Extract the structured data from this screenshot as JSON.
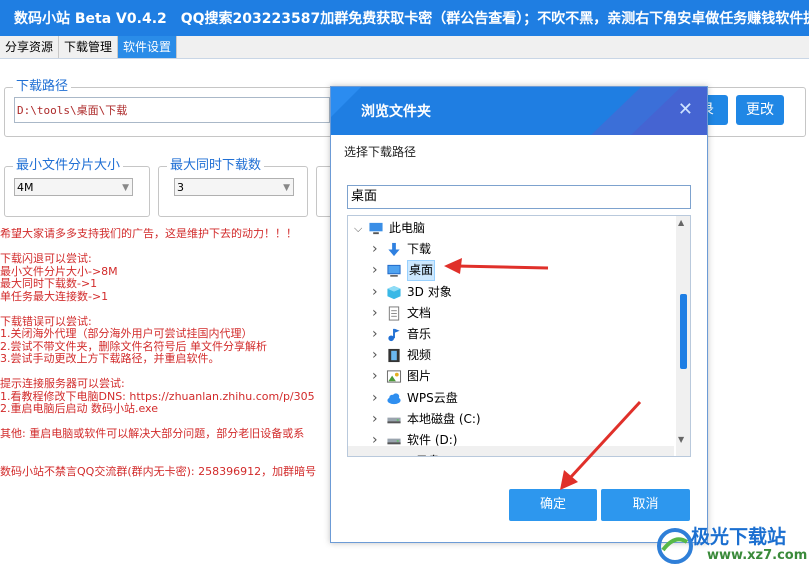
{
  "app": {
    "title": "数码小站 Beta V0.4.2",
    "notice": "QQ搜索203223587加群免费获取卡密（群公告查看）；不吹不黑，亲测右下角安卓做任务赚钱软件提"
  },
  "tabs": [
    {
      "label": "分享资源"
    },
    {
      "label": "下载管理"
    },
    {
      "label": "软件设置"
    }
  ],
  "download_path": {
    "label": "下载路径",
    "value": "D:\\tools\\桌面\\下载",
    "record_label": "录",
    "change_label": "更改"
  },
  "settings": {
    "min_chunk_label": "最小文件分片大小",
    "min_chunk_value": "4M",
    "max_downloads_label": "最大同时下载数",
    "max_downloads_value": "3"
  },
  "log_lines": [
    "希望大家请多多支持我们的广告，这是维护下去的动力！！！",
    "",
    "下载闪退可以尝试:",
    "最小文件分片大小->8M",
    "最大同时下载数->1",
    "单任务最大连接数->1",
    "",
    "下载错误可以尝试:",
    "1.关闭海外代理（部分海外用户可尝试挂国内代理）",
    "2.尝试不带文件夹，删除文件名符号后 单文件分享解析",
    "3.尝试手动更改上方下载路径，并重启软件。",
    "",
    "提示连接服务器可以尝试:",
    "1.看教程修改下电脑DNS: https://zhuanlan.zhihu.com/p/305",
    "2.重启电脑后启动 数码小站.exe",
    "",
    "其他: 重启电脑或软件可以解决大部分问题，部分老旧设备或系",
    "",
    "",
    "数码小站不禁言QQ交流群(群内无卡密): 258396912，加群暗号"
  ],
  "dialog": {
    "title": "浏览文件夹",
    "prompt": "选择下载路径",
    "path_value": "桌面",
    "ok_label": "确定",
    "cancel_label": "取消",
    "tree": [
      {
        "label": "此电脑",
        "icon": "computer-icon",
        "level": 0,
        "expanded": true
      },
      {
        "label": "下载",
        "icon": "download-arrow-icon",
        "level": 1
      },
      {
        "label": "桌面",
        "icon": "desktop-icon",
        "level": 1,
        "selected": true
      },
      {
        "label": "3D 对象",
        "icon": "cube-icon",
        "level": 1
      },
      {
        "label": "文档",
        "icon": "document-icon",
        "level": 1
      },
      {
        "label": "音乐",
        "icon": "music-note-icon",
        "level": 1
      },
      {
        "label": "视频",
        "icon": "film-icon",
        "level": 1
      },
      {
        "label": "图片",
        "icon": "picture-icon",
        "level": 1
      },
      {
        "label": "WPS云盘",
        "icon": "cloud-icon",
        "level": 1
      },
      {
        "label": "本地磁盘 (C:)",
        "icon": "drive-icon",
        "level": 1
      },
      {
        "label": "软件 (D:)",
        "icon": "drive-icon",
        "level": 1
      },
      {
        "label": "WPS云盘",
        "icon": "cloud-icon",
        "level": 0
      }
    ]
  },
  "watermark": {
    "name": "极光下载站",
    "url": "www.xz7.com"
  },
  "colors": {
    "accent": "#1f7ee2",
    "log_text": "#d22b2b",
    "annotation_arrow": "#e0302a"
  }
}
